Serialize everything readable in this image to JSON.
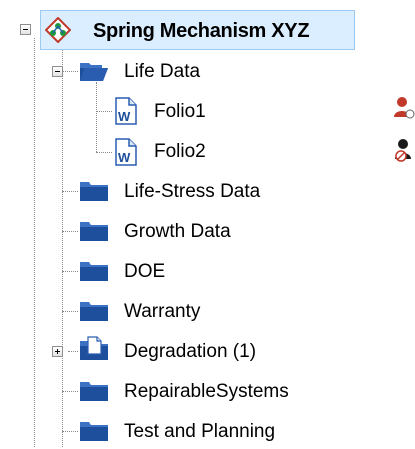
{
  "tree": {
    "root": {
      "label": "Spring Mechanism XYZ",
      "icon": "system-hierarchy-icon",
      "expanded": true
    },
    "life_data": {
      "label": "Life Data",
      "icon": "folder-open-icon",
      "expanded": true,
      "folios": [
        {
          "label": "Folio1",
          "icon": "folio-document-icon",
          "status_icon": "user-checked-icon"
        },
        {
          "label": "Folio2",
          "icon": "folio-document-icon",
          "status_icon": "user-restricted-icon"
        }
      ]
    },
    "folders": [
      {
        "label": "Life-Stress Data",
        "icon": "folder-icon"
      },
      {
        "label": "Growth Data",
        "icon": "folder-icon"
      },
      {
        "label": "DOE",
        "icon": "folder-icon"
      },
      {
        "label": "Warranty",
        "icon": "folder-icon"
      },
      {
        "label": "Degradation (1)",
        "icon": "folder-with-document-icon",
        "expandable": true
      },
      {
        "label": "RepairableSystems",
        "icon": "folder-icon"
      },
      {
        "label": "Test and Planning",
        "icon": "folder-icon"
      }
    ],
    "colors": {
      "folder_blue": "#1d4f9c",
      "folder_tab": "#3c72c4",
      "selection_bg": "#dbeeff",
      "selection_border": "#9ccaf3",
      "status_red": "#c0392b"
    }
  }
}
